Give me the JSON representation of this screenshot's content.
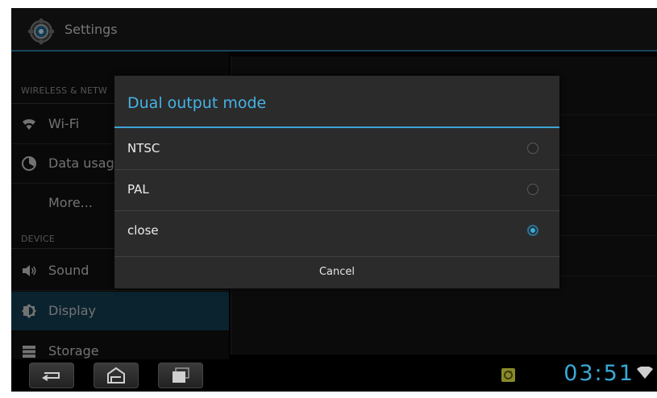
{
  "app": {
    "title": "Settings"
  },
  "left_pane": {
    "sections": [
      {
        "header": "WIRELESS & NETW"
      },
      {
        "header": "DEVICE"
      }
    ],
    "items": [
      {
        "label": "Wi-Fi",
        "icon": "wifi-icon"
      },
      {
        "label": "Data usag",
        "icon": "data-usage-icon"
      },
      {
        "label": "More...",
        "icon": ""
      },
      {
        "label": "Sound",
        "icon": "speaker-icon"
      },
      {
        "label": "Display",
        "icon": "brightness-icon",
        "selected": true
      },
      {
        "label": "Storage",
        "icon": "storage-icon"
      }
    ]
  },
  "dialog": {
    "title": "Dual output mode",
    "options": [
      {
        "label": "NTSC",
        "checked": false
      },
      {
        "label": "PAL",
        "checked": false
      },
      {
        "label": "close",
        "checked": true
      }
    ],
    "cancel_label": "Cancel"
  },
  "navbar": {
    "buttons": [
      "back-icon",
      "home-icon",
      "recent-apps-icon"
    ]
  },
  "status": {
    "time": "03:51",
    "icons": [
      "sync-icon",
      "wifi-signal-icon"
    ]
  },
  "colors": {
    "accent": "#37aee5",
    "selected_bg": "#144157",
    "clock": "#39a9d8"
  }
}
